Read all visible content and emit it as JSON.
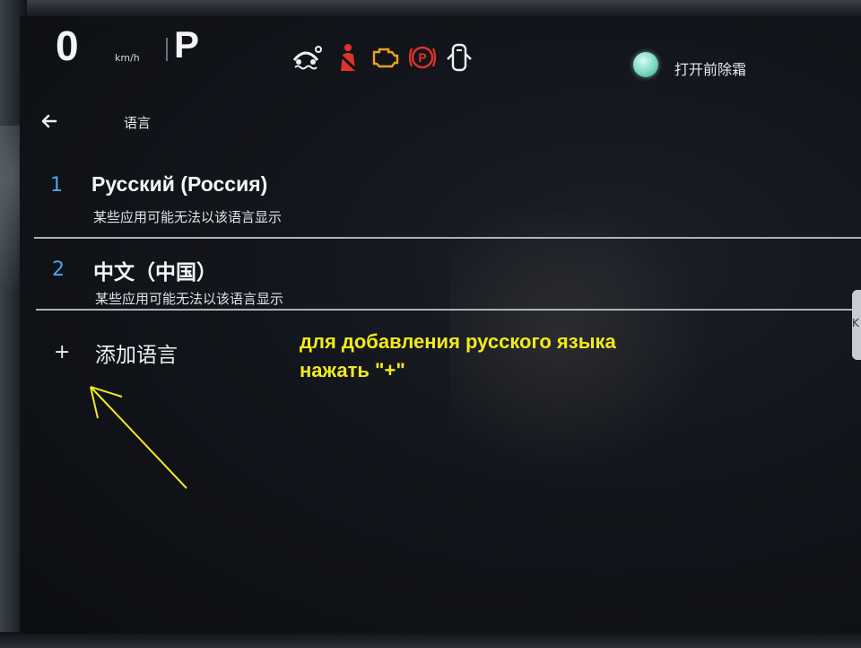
{
  "status_bar": {
    "speed_value": "0",
    "speed_unit": "km/h",
    "gear": "P",
    "warning_icons": [
      "traction-control-icon",
      "seatbelt-icon",
      "check-engine-icon",
      "parking-brake-icon",
      "door-open-icon"
    ],
    "defrost_label": "打开前除霜"
  },
  "header": {
    "title": "语言"
  },
  "languages": [
    {
      "index": "1",
      "name": "Русский (Россия)",
      "note": "某些应用可能无法以该语言显示"
    },
    {
      "index": "2",
      "name": "中文（中国）",
      "note": "某些应用可能无法以该语言显示"
    }
  ],
  "add_language": {
    "plus": "+",
    "label": "添加语言"
  },
  "side_tab": {
    "label": "K"
  },
  "annotation": {
    "line1": "для добавления русского языка",
    "line2": "нажать \"+\""
  },
  "colors": {
    "accent_number": "#49a6e8",
    "warning_red": "#e0332a",
    "warning_amber": "#f0a020",
    "annotation_yellow": "#f2ea1c",
    "defrost_indicator": "#7ad8c4"
  }
}
